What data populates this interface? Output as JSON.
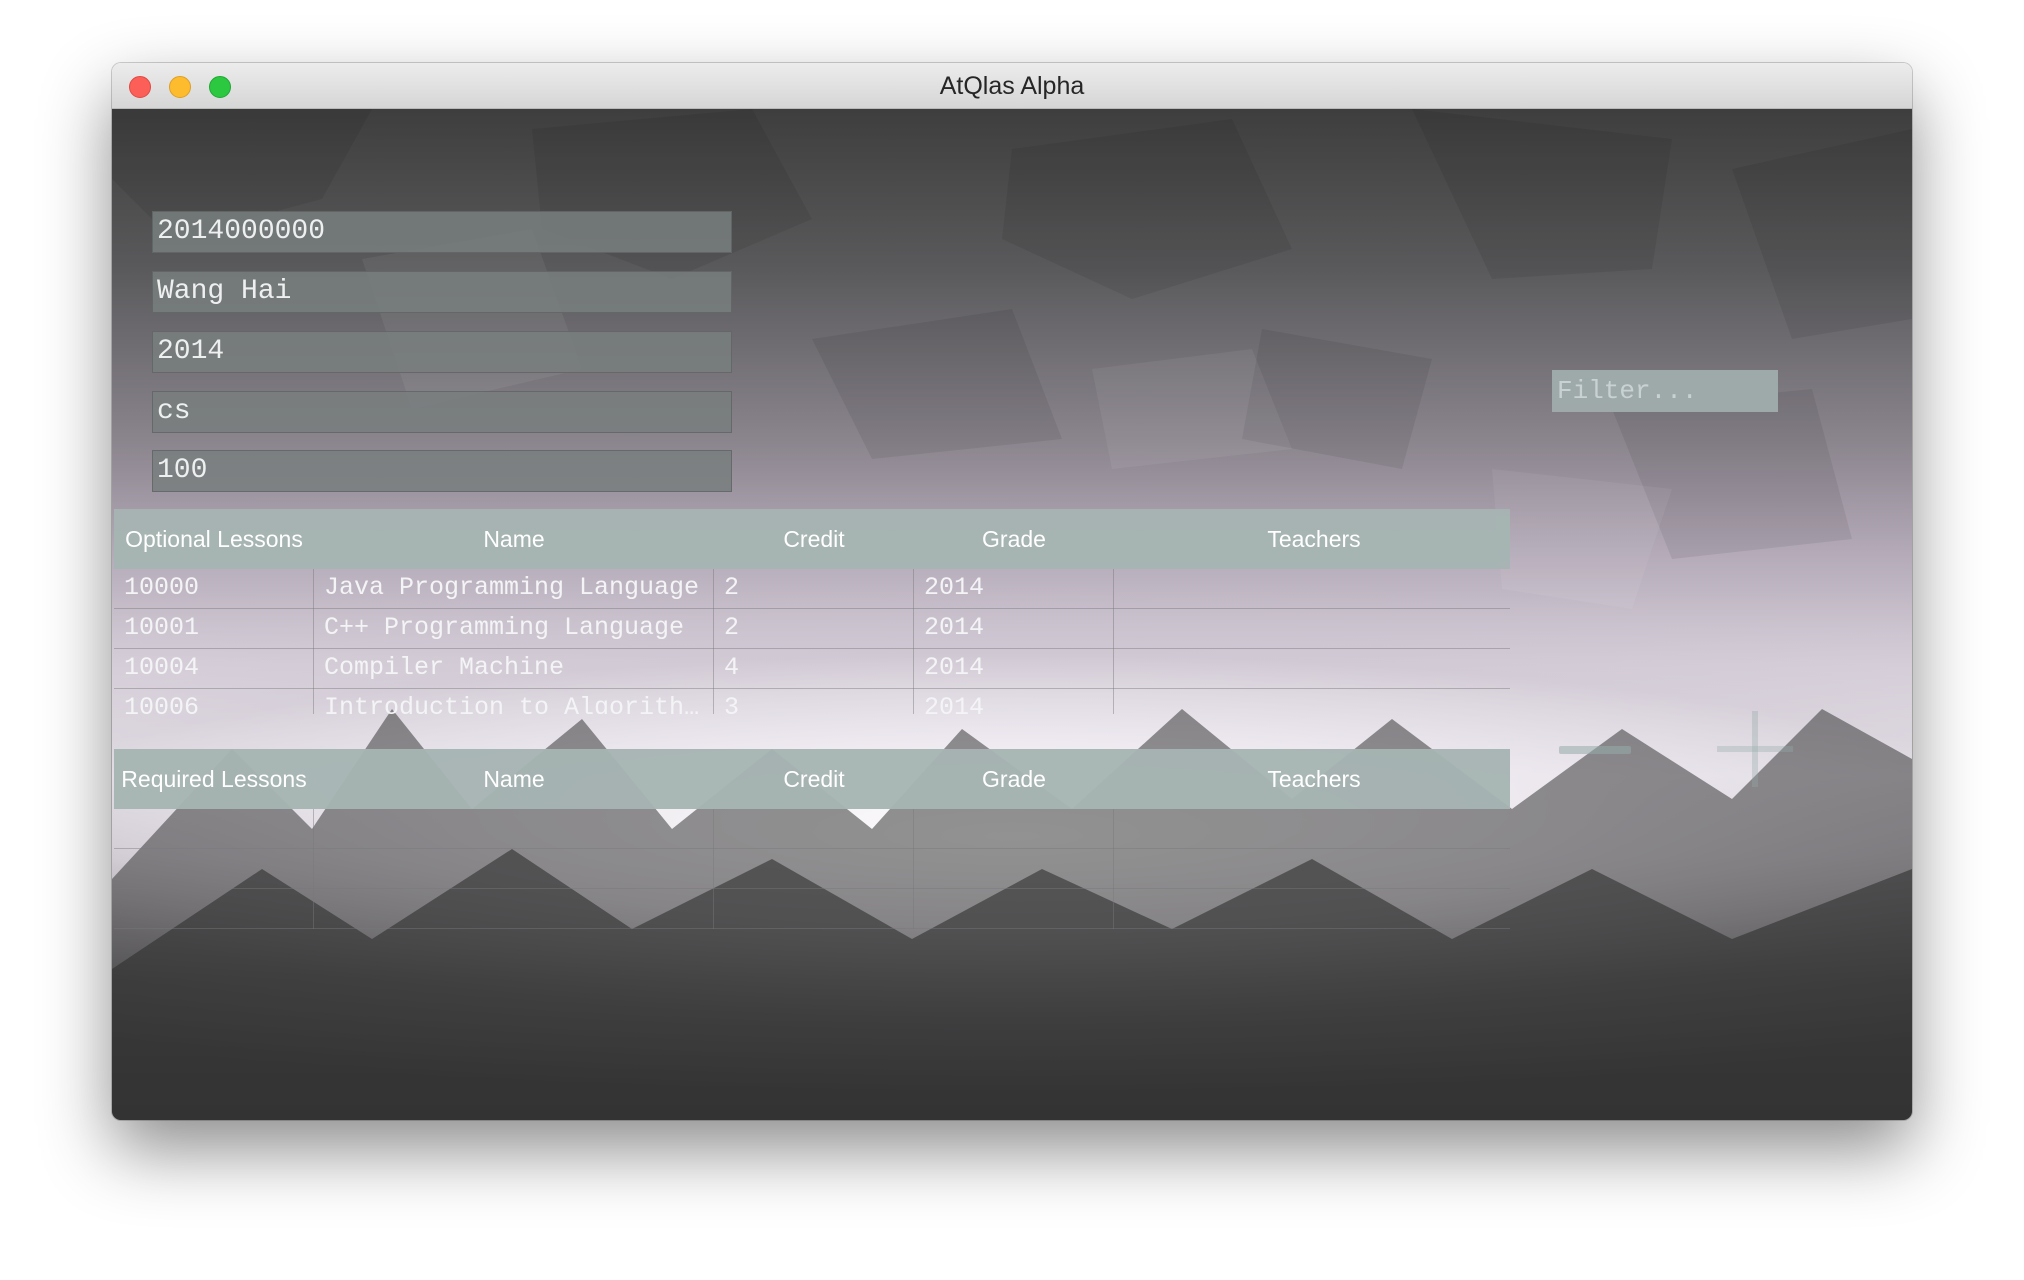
{
  "window": {
    "title": "AtQlas Alpha"
  },
  "student": {
    "id": "2014000000",
    "name": "Wang Hai",
    "year": "2014",
    "major": "cs",
    "score": "100"
  },
  "filter": {
    "placeholder": "Filter..."
  },
  "optional_table": {
    "headers": {
      "id": "Optional Lessons",
      "name": "Name",
      "credit": "Credit",
      "grade": "Grade",
      "teachers": "Teachers"
    },
    "rows": [
      {
        "id": "10000",
        "name": "Java Programming Language",
        "credit": "2",
        "grade": "2014",
        "teachers": ""
      },
      {
        "id": "10001",
        "name": "C++ Programming Language",
        "credit": "2",
        "grade": "2014",
        "teachers": ""
      },
      {
        "id": "10004",
        "name": "Compiler Machine",
        "credit": "4",
        "grade": "2014",
        "teachers": ""
      },
      {
        "id": "10006",
        "name": "Introduction to Algorithms",
        "credit": "3",
        "grade": "2014",
        "teachers": ""
      }
    ]
  },
  "required_table": {
    "headers": {
      "id": "Required Lessons",
      "name": "Name",
      "credit": "Credit",
      "grade": "Grade",
      "teachers": "Teachers"
    },
    "rows": []
  },
  "controls": {
    "remove_icon": "minus-icon",
    "add_icon": "plus-icon"
  }
}
